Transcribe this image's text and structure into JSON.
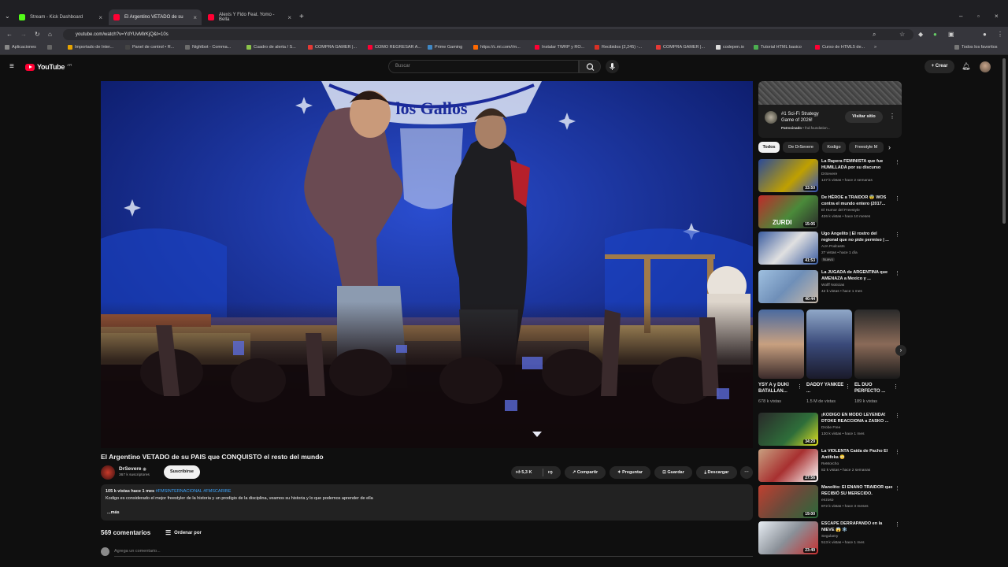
{
  "browser": {
    "tabs": [
      {
        "title": "Stream - Kick Dashboard",
        "color": "#53fc18"
      },
      {
        "title": "El Argentino VETADO de su",
        "color": "#ff0033"
      },
      {
        "title": "Alexis Y Fido Feat. Yomo - Bella",
        "color": "#ff0033"
      }
    ],
    "new_tab": "+",
    "url": "youtube.com/watch?v=YdYUvMIrKjQ&t=10s",
    "bookmarks": [
      {
        "label": "Aplicaciones",
        "color": "#888"
      },
      {
        "label": "Importado de Inter...",
        "color": "#e7a400"
      },
      {
        "label": "Panel de control • R...",
        "color": "#444"
      },
      {
        "label": "Nightbot - Comma...",
        "color": "#6c6c6c"
      },
      {
        "label": "Cuadro de alerta / S...",
        "color": "#8bc34a"
      },
      {
        "label": "COMPRA GAMER |...",
        "color": "#e53935"
      },
      {
        "label": "COMO REGRESAR A...",
        "color": "#ff0033"
      },
      {
        "label": "Prime Gaming",
        "color": "#3f88c5"
      },
      {
        "label": "https://c.mi.com//m...",
        "color": "#ff6900"
      },
      {
        "label": "Instalar TWRP y RO...",
        "color": "#ff0033"
      },
      {
        "label": "Recibidos (2,245) -...",
        "color": "#d93025"
      },
      {
        "label": "COMPRA GAMER |...",
        "color": "#e53935"
      },
      {
        "label": "codepen.io",
        "color": "#ddd"
      },
      {
        "label": "Tutorial HTML basico",
        "color": "#4caf50"
      },
      {
        "label": "Curso de HTML5 de...",
        "color": "#ff0033"
      }
    ],
    "all_bookmarks": "Todos los favoritos"
  },
  "yt": {
    "logo": "YouTube",
    "region": "AR",
    "search_placeholder": "Buscar",
    "create": "+ Crear"
  },
  "video": {
    "title": "El Argentino VETADO de su PAIS que CONQUISTO el resto del mundo",
    "stage_sign": "los Gallos",
    "channel": "DrSevere",
    "subscribers": "367 k suscriptores",
    "subscribe": "Suscribirse",
    "likes": "5,3 K",
    "share": "Compartir",
    "ask": "Preguntar",
    "save": "Guardar",
    "download": "Descargar",
    "tooltip": "Descargar",
    "desc_views": "105 k vistas  hace 1 mes",
    "desc_tags": "#FMSINTERNACIONAL #FMSCARIBE",
    "desc_text": "Kodigo es considerado el mejor freestyler de la historia y un prodigio de la disciplina, veamos su historia y lo que podemos aprender de ella",
    "desc_more": "...más"
  },
  "comments": {
    "count": "569 comentarios",
    "sort": "Ordenar por",
    "placeholder": "Agrega un comentario..."
  },
  "ad": {
    "title": "#1 Sci-Fi Strategy Game of 2026!",
    "sponsored": "Patrocinado",
    "domain": "fnd.foundation...",
    "cta": "Visitar sitio"
  },
  "chips": [
    "Todos",
    "De DrSevere",
    "Kodigo",
    "Freestyle M"
  ],
  "related_top": [
    {
      "title": "La Rapera FEMINISTA que fue HUMILLADA por su discurso",
      "channel": "DrSevere",
      "meta": "147 k vistas • hace 2 semanas",
      "dur": "33:50",
      "color": "#3b5ea8"
    },
    {
      "title": "De HÉROE a TRAIDOR 😨 WOS contra el mundo entero (2017...",
      "channel": "El Humor del Freestyle",
      "meta": "426 k vistas • hace 10 meses",
      "dur": "15:05",
      "color": "#8b3a2a"
    },
    {
      "title": "Ugo Angelito | El rostro del regional que no pide permiso | ...",
      "channel": "AJA Podcasts",
      "meta": "27 vistas • hace 1 día",
      "dur": "41:53",
      "color": "#3a5ca0",
      "badge": "Nuevo"
    },
    {
      "title": "La JUGADA de ARGENTINA que AMENAZA a Mexico y ...",
      "channel": "Wolff Noticias",
      "meta": "42 k vistas • hace 1 mes",
      "dur": "40:44",
      "color": "#5d7aa8"
    }
  ],
  "shorts": [
    {
      "title": "YSY A y DUKI BATALLAN...",
      "views": "678 k vistas",
      "color": "#7a5a48"
    },
    {
      "title": "DADDY YANKEE ...",
      "views": "1.5 M de vistas",
      "color": "#4a5d8c"
    },
    {
      "title": "EL DUO PERFECTO ...",
      "views": "189 k vistas",
      "color": "#3b3b3b"
    }
  ],
  "related_bottom": [
    {
      "title": "¡KODIGO EN MODO LEYENDA! DTOKE REACCIONA a ZASKO ...",
      "channel": "Drobe Free",
      "meta": "130 k vistas • hace 1 mes",
      "dur": "34:29",
      "color": "#2e6e3a"
    },
    {
      "title": "La VIOLENTA Caída de Pacho El Antifeka 😳",
      "channel": "ReMorcho",
      "meta": "82 k vistas • hace 2 semanas",
      "dur": "27:56",
      "color": "#a83030"
    },
    {
      "title": "Manolito: El ENANO TRAIDOR que RECIBIÓ SU MERECIDO.",
      "channel": "enzoso",
      "meta": "872 k vistas • hace 3 meses",
      "dur": "19:00",
      "color": "#6a4a3a"
    },
    {
      "title": "ESCAPE DERRAPANDO en la NIEVE 😱 ❄️",
      "channel": "Segulamy",
      "meta": "513 k vistas • hace 1 mes",
      "dur": "23:49",
      "color": "#8a9098"
    }
  ]
}
